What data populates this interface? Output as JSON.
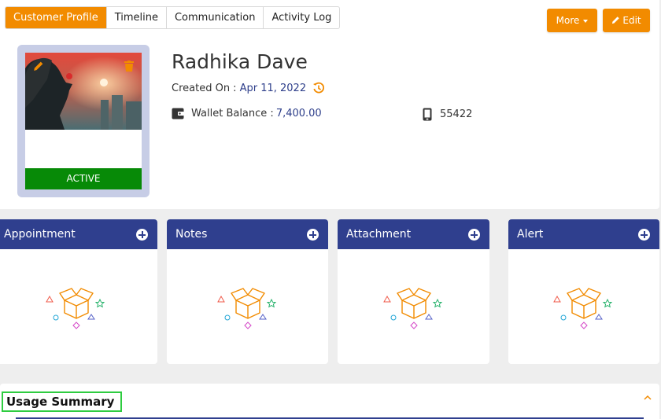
{
  "tabs": [
    {
      "label": "Customer Profile",
      "active": true
    },
    {
      "label": "Timeline",
      "active": false
    },
    {
      "label": "Communication",
      "active": false
    },
    {
      "label": "Activity Log",
      "active": false
    }
  ],
  "actions": {
    "more_label": "More",
    "edit_label": "Edit"
  },
  "profile": {
    "name": "Radhika Dave",
    "created_label": "Created On :",
    "created_date": "Apr 11, 2022",
    "wallet_label": "Wallet Balance :",
    "wallet_value": "7,400.00",
    "phone": "55422",
    "status": "ACTIVE"
  },
  "widgets": [
    {
      "title": "Appointment"
    },
    {
      "title": "Notes"
    },
    {
      "title": "Attachment"
    },
    {
      "title": "Alert"
    }
  ],
  "summary": {
    "title": "Usage Summary"
  },
  "colors": {
    "accent": "#f28b00",
    "header_blue": "#2f3f8e",
    "status_active": "#078a07",
    "link_blue": "#2d3e8a",
    "highlight_green": "#2ecc40"
  },
  "icons": {
    "history": "history-icon",
    "wallet": "wallet-icon",
    "phone": "mobile-phone-icon",
    "edit": "pencil-icon",
    "add": "plus-circle-icon",
    "empty": "empty-box-icon"
  }
}
